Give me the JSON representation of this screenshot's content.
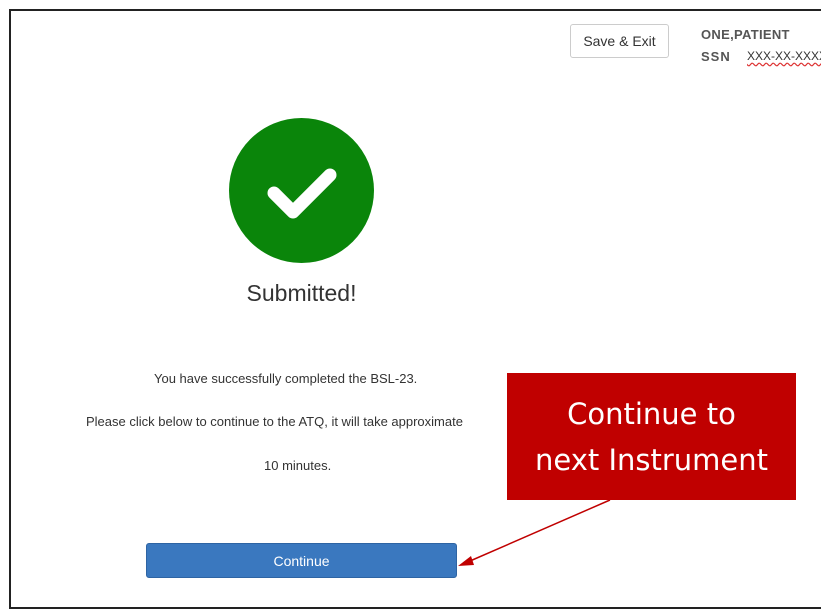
{
  "header": {
    "save_exit_label": "Save & Exit",
    "patient_name": "ONE,PATIENT",
    "ssn_label": "SSN",
    "ssn_value": "XXX-XX-XXXX"
  },
  "status": {
    "icon": "checkmark-circle-icon",
    "color": "#0a850a",
    "title": "Submitted!"
  },
  "message": {
    "line1": "You have successfully completed the BSL-23.",
    "line2": "Please click below to continue to the ATQ, it will take approximate",
    "line3": "10 minutes."
  },
  "actions": {
    "continue_label": "Continue"
  },
  "annotation": {
    "line1": "Continue to",
    "line2": "next Instrument",
    "color": "#c00000"
  }
}
